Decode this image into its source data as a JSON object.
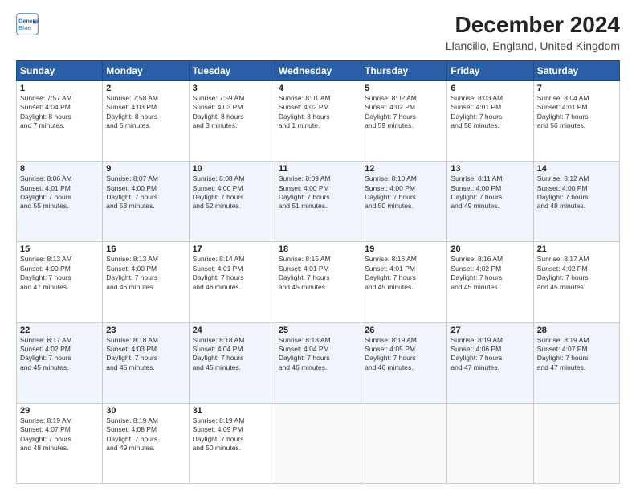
{
  "logo": {
    "line1": "General",
    "line2": "Blue"
  },
  "title": "December 2024",
  "subtitle": "Llancillo, England, United Kingdom",
  "days_of_week": [
    "Sunday",
    "Monday",
    "Tuesday",
    "Wednesday",
    "Thursday",
    "Friday",
    "Saturday"
  ],
  "weeks": [
    [
      {
        "day": "1",
        "info": "Sunrise: 7:57 AM\nSunset: 4:04 PM\nDaylight: 8 hours\nand 7 minutes."
      },
      {
        "day": "2",
        "info": "Sunrise: 7:58 AM\nSunset: 4:03 PM\nDaylight: 8 hours\nand 5 minutes."
      },
      {
        "day": "3",
        "info": "Sunrise: 7:59 AM\nSunset: 4:03 PM\nDaylight: 8 hours\nand 3 minutes."
      },
      {
        "day": "4",
        "info": "Sunrise: 8:01 AM\nSunset: 4:02 PM\nDaylight: 8 hours\nand 1 minute."
      },
      {
        "day": "5",
        "info": "Sunrise: 8:02 AM\nSunset: 4:02 PM\nDaylight: 7 hours\nand 59 minutes."
      },
      {
        "day": "6",
        "info": "Sunrise: 8:03 AM\nSunset: 4:01 PM\nDaylight: 7 hours\nand 58 minutes."
      },
      {
        "day": "7",
        "info": "Sunrise: 8:04 AM\nSunset: 4:01 PM\nDaylight: 7 hours\nand 56 minutes."
      }
    ],
    [
      {
        "day": "8",
        "info": "Sunrise: 8:06 AM\nSunset: 4:01 PM\nDaylight: 7 hours\nand 55 minutes."
      },
      {
        "day": "9",
        "info": "Sunrise: 8:07 AM\nSunset: 4:00 PM\nDaylight: 7 hours\nand 53 minutes."
      },
      {
        "day": "10",
        "info": "Sunrise: 8:08 AM\nSunset: 4:00 PM\nDaylight: 7 hours\nand 52 minutes."
      },
      {
        "day": "11",
        "info": "Sunrise: 8:09 AM\nSunset: 4:00 PM\nDaylight: 7 hours\nand 51 minutes."
      },
      {
        "day": "12",
        "info": "Sunrise: 8:10 AM\nSunset: 4:00 PM\nDaylight: 7 hours\nand 50 minutes."
      },
      {
        "day": "13",
        "info": "Sunrise: 8:11 AM\nSunset: 4:00 PM\nDaylight: 7 hours\nand 49 minutes."
      },
      {
        "day": "14",
        "info": "Sunrise: 8:12 AM\nSunset: 4:00 PM\nDaylight: 7 hours\nand 48 minutes."
      }
    ],
    [
      {
        "day": "15",
        "info": "Sunrise: 8:13 AM\nSunset: 4:00 PM\nDaylight: 7 hours\nand 47 minutes."
      },
      {
        "day": "16",
        "info": "Sunrise: 8:13 AM\nSunset: 4:00 PM\nDaylight: 7 hours\nand 46 minutes."
      },
      {
        "day": "17",
        "info": "Sunrise: 8:14 AM\nSunset: 4:01 PM\nDaylight: 7 hours\nand 46 minutes."
      },
      {
        "day": "18",
        "info": "Sunrise: 8:15 AM\nSunset: 4:01 PM\nDaylight: 7 hours\nand 45 minutes."
      },
      {
        "day": "19",
        "info": "Sunrise: 8:16 AM\nSunset: 4:01 PM\nDaylight: 7 hours\nand 45 minutes."
      },
      {
        "day": "20",
        "info": "Sunrise: 8:16 AM\nSunset: 4:02 PM\nDaylight: 7 hours\nand 45 minutes."
      },
      {
        "day": "21",
        "info": "Sunrise: 8:17 AM\nSunset: 4:02 PM\nDaylight: 7 hours\nand 45 minutes."
      }
    ],
    [
      {
        "day": "22",
        "info": "Sunrise: 8:17 AM\nSunset: 4:02 PM\nDaylight: 7 hours\nand 45 minutes."
      },
      {
        "day": "23",
        "info": "Sunrise: 8:18 AM\nSunset: 4:03 PM\nDaylight: 7 hours\nand 45 minutes."
      },
      {
        "day": "24",
        "info": "Sunrise: 8:18 AM\nSunset: 4:04 PM\nDaylight: 7 hours\nand 45 minutes."
      },
      {
        "day": "25",
        "info": "Sunrise: 8:18 AM\nSunset: 4:04 PM\nDaylight: 7 hours\nand 46 minutes."
      },
      {
        "day": "26",
        "info": "Sunrise: 8:19 AM\nSunset: 4:05 PM\nDaylight: 7 hours\nand 46 minutes."
      },
      {
        "day": "27",
        "info": "Sunrise: 8:19 AM\nSunset: 4:06 PM\nDaylight: 7 hours\nand 47 minutes."
      },
      {
        "day": "28",
        "info": "Sunrise: 8:19 AM\nSunset: 4:07 PM\nDaylight: 7 hours\nand 47 minutes."
      }
    ],
    [
      {
        "day": "29",
        "info": "Sunrise: 8:19 AM\nSunset: 4:07 PM\nDaylight: 7 hours\nand 48 minutes."
      },
      {
        "day": "30",
        "info": "Sunrise: 8:19 AM\nSunset: 4:08 PM\nDaylight: 7 hours\nand 49 minutes."
      },
      {
        "day": "31",
        "info": "Sunrise: 8:19 AM\nSunset: 4:09 PM\nDaylight: 7 hours\nand 50 minutes."
      },
      {
        "day": "",
        "info": ""
      },
      {
        "day": "",
        "info": ""
      },
      {
        "day": "",
        "info": ""
      },
      {
        "day": "",
        "info": ""
      }
    ]
  ]
}
